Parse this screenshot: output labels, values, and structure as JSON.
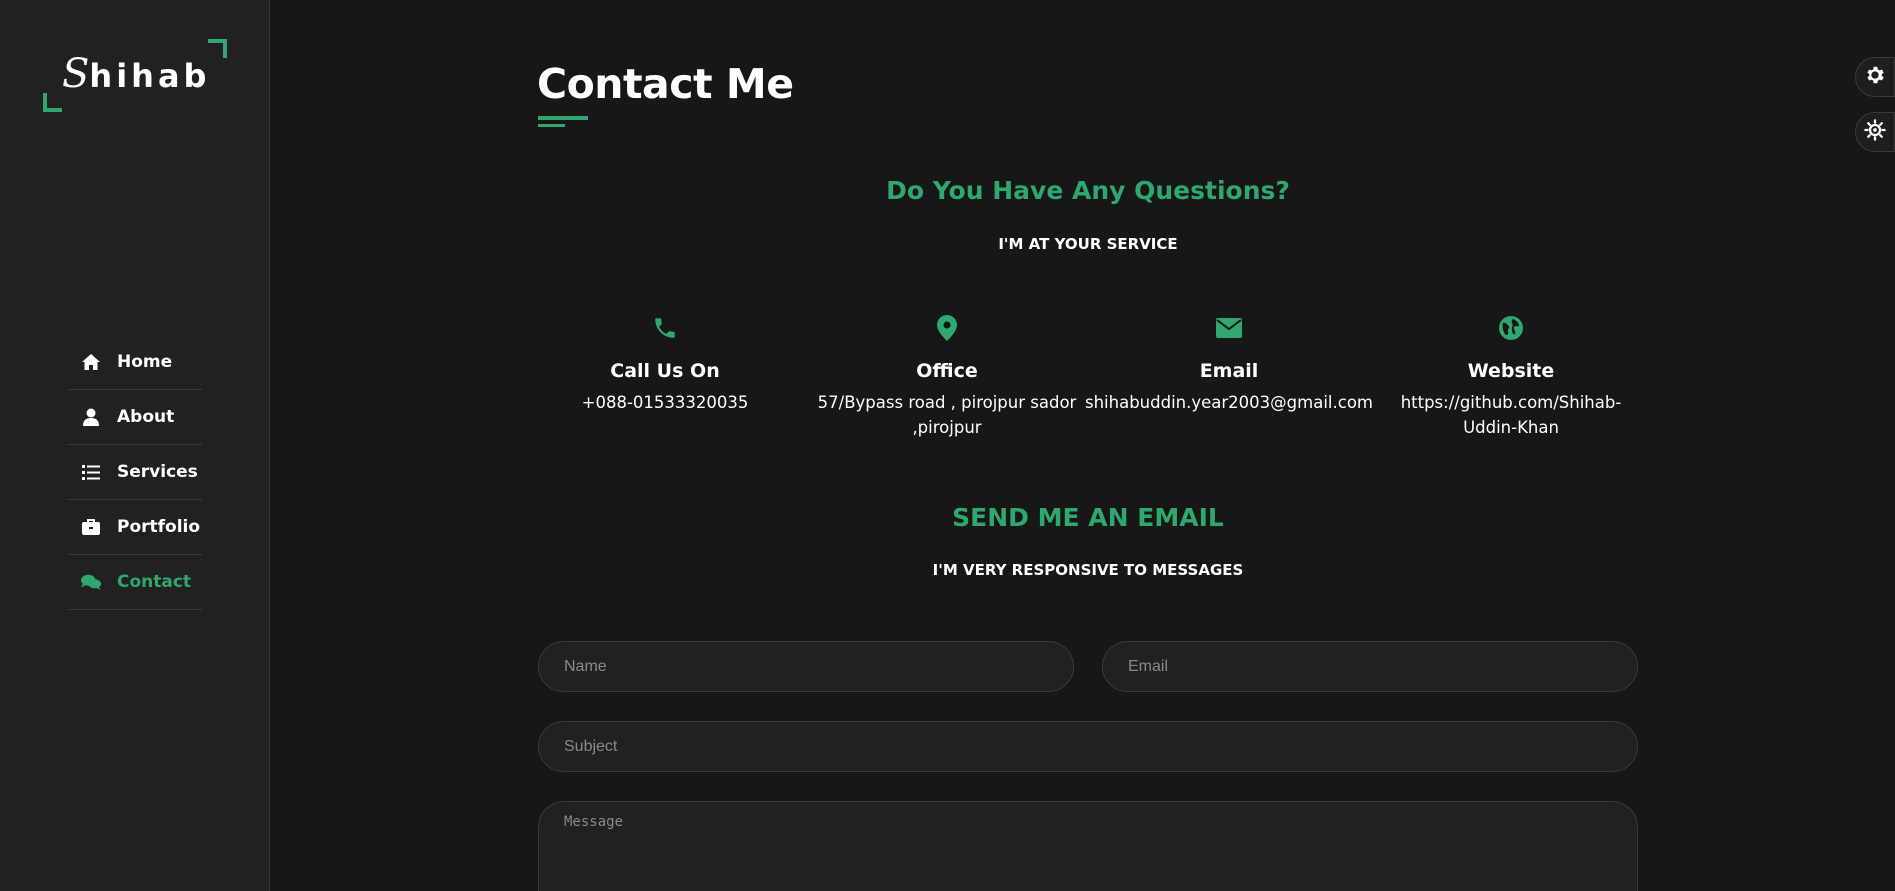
{
  "brand": {
    "logo_text": "hihab",
    "logo_initial": "S",
    "accent_color": "#2ea86f"
  },
  "sidebar": {
    "items": [
      {
        "label": "Home",
        "icon": "home-icon"
      },
      {
        "label": "About",
        "icon": "user-icon"
      },
      {
        "label": "Services",
        "icon": "list-icon"
      },
      {
        "label": "Portfolio",
        "icon": "briefcase-icon"
      },
      {
        "label": "Contact",
        "icon": "comments-icon",
        "active": true
      }
    ]
  },
  "main": {
    "title": "Contact Me",
    "questions_heading": "Do You Have Any Questions?",
    "service_subheading": "I'M AT YOUR SERVICE",
    "info": [
      {
        "icon": "phone-icon",
        "title": "Call Us On",
        "value": "+088-01533320035"
      },
      {
        "icon": "map-marker-icon",
        "title": "Office",
        "value": "57/Bypass road , pirojpur sador ,pirojpur"
      },
      {
        "icon": "envelope-icon",
        "title": "Email",
        "value": "shihabuddin.year2003@gmail.com"
      },
      {
        "icon": "globe-icon",
        "title": "Website",
        "value": "https://github.com/Shihab-Uddin-Khan"
      }
    ],
    "email_heading": "SEND ME AN EMAIL",
    "responsive_subheading": "I'M VERY RESPONSIVE TO MESSAGES",
    "form": {
      "name_placeholder": "Name",
      "email_placeholder": "Email",
      "subject_placeholder": "Subject",
      "message_placeholder": "Message"
    }
  },
  "floating_controls": [
    {
      "icon": "gear-icon"
    },
    {
      "icon": "sun-gear-icon"
    }
  ]
}
